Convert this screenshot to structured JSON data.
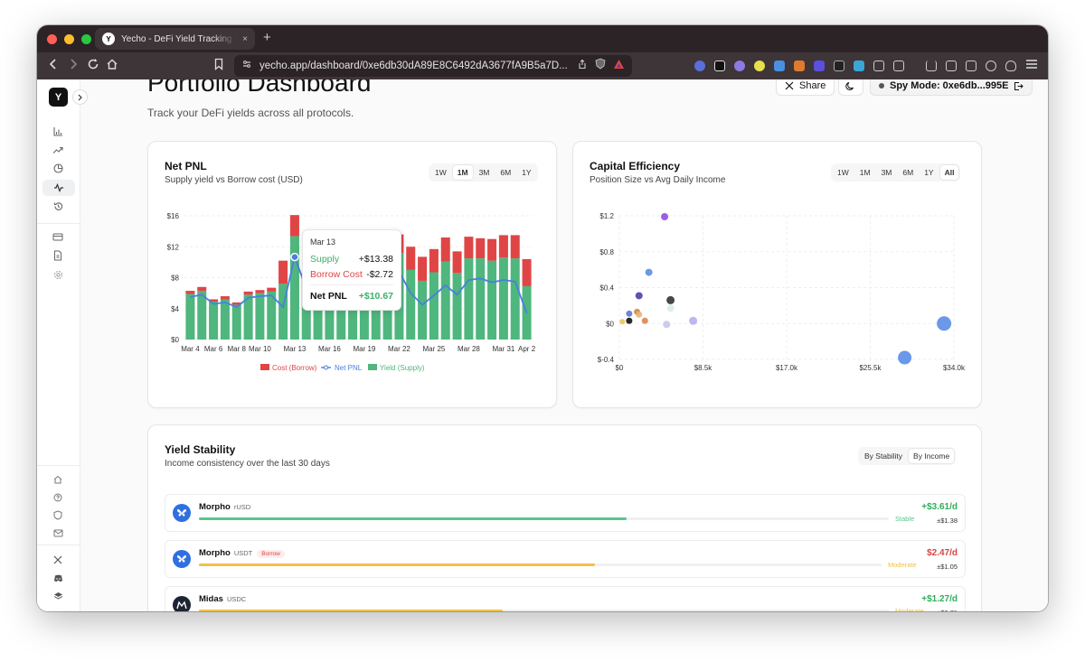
{
  "browser": {
    "tab_title": "Yecho - DeFi Yield Tracking Platform",
    "tab_favicon": "Y",
    "url": "yecho.app/dashboard/0xe6db30dA89E8C6492dA3677fA9B5a7D...",
    "new_tab": "+",
    "close_tab": "×"
  },
  "sidebar": {
    "logo": "Y",
    "collapse_icon": "chevron-right-icon",
    "nav_icons": [
      "bar-chart-icon",
      "trending-up-icon",
      "pie-chart-icon",
      "activity-icon",
      "history-icon",
      "credit-card-icon",
      "document-icon",
      "settings-icon"
    ],
    "footer_icons": [
      "home-icon",
      "help-icon",
      "shield-icon",
      "mail-icon",
      "x-logo-icon",
      "discord-icon",
      "layers-icon"
    ]
  },
  "header": {
    "title": "Portfolio Dashboard",
    "subtitle": "Track your DeFi yields across all protocols.",
    "share_label": "Share",
    "spy_label": "Spy Mode: 0xe6db...995E"
  },
  "net_pnl": {
    "title": "Net PNL",
    "subtitle": "Supply yield vs Borrow cost (USD)",
    "ranges": [
      "1W",
      "1M",
      "3M",
      "6M",
      "1Y"
    ],
    "active_range": "1M",
    "tooltip": {
      "date": "Mar 13",
      "supply_label": "Supply",
      "supply_value": "+$13.38",
      "borrow_label": "Borrow Cost",
      "borrow_value": "-$2.72",
      "net_label": "Net PNL",
      "net_value": "+$10.67"
    }
  },
  "capital_efficiency": {
    "title": "Capital Efficiency",
    "subtitle": "Position Size vs Avg Daily Income",
    "ranges": [
      "1W",
      "1M",
      "3M",
      "6M",
      "1Y",
      "All"
    ],
    "active_range": "All"
  },
  "yield_stability": {
    "title": "Yield Stability",
    "subtitle": "Income consistency over the last 30 days",
    "sort_options": [
      "By Stability",
      "By Income"
    ],
    "active_sort": "By Income",
    "rows": [
      {
        "protocol": "Morpho",
        "asset": "rUSD",
        "badge": "",
        "amount": "+$3.61/d",
        "deviation": "±$1.38",
        "status": "Stable",
        "fill": 0.62,
        "color": "#5bc48c",
        "amount_color": "#2fae5b",
        "logo": "butterfly-icon",
        "logo_bg": "#2f6fe0"
      },
      {
        "protocol": "Morpho",
        "asset": "USDT",
        "badge": "Borrow",
        "amount": "$2.47/d",
        "deviation": "±$1.05",
        "status": "Moderate",
        "fill": 0.58,
        "color": "#f0c24a",
        "amount_color": "#d64545",
        "logo": "butterfly-icon",
        "logo_bg": "#2f6fe0"
      },
      {
        "protocol": "Midas",
        "asset": "USDC",
        "badge": "",
        "amount": "+$1.27/d",
        "deviation": "±$0.71",
        "status": "Moderate",
        "fill": 0.44,
        "color": "#f0c24a",
        "amount_color": "#2fae5b",
        "logo": "midas-icon",
        "logo_bg": "#1d2433"
      }
    ]
  },
  "chart_data": [
    {
      "type": "bar",
      "title": "Net PNL",
      "subtitle": "Supply yield vs Borrow cost (USD)",
      "ylim": [
        0,
        16
      ],
      "yticks": [
        "$0",
        "$4",
        "$8",
        "$12",
        "$16"
      ],
      "ytick_values": [
        0,
        4,
        8,
        12,
        16
      ],
      "categories": [
        "Mar 4",
        "Mar 5",
        "Mar 6",
        "Mar 7",
        "Mar 8",
        "Mar 9",
        "Mar 10",
        "Mar 11",
        "Mar 12",
        "Mar 13",
        "Mar 14",
        "Mar 15",
        "Mar 16",
        "Mar 17",
        "Mar 18",
        "Mar 19",
        "Mar 20",
        "Mar 21",
        "Mar 22",
        "Mar 23",
        "Mar 24",
        "Mar 25",
        "Mar 26",
        "Mar 27",
        "Mar 28",
        "Mar 29",
        "Mar 30",
        "Mar 31",
        "Apr 1",
        "Apr 2"
      ],
      "xtick_labels": [
        "Mar 4",
        "Mar 6",
        "Mar 8",
        "Mar 10",
        "Mar 13",
        "Mar 16",
        "Mar 19",
        "Mar 22",
        "Mar 25",
        "Mar 28",
        "Mar 31",
        "Apr 2"
      ],
      "xtick_index": [
        0,
        2,
        4,
        6,
        9,
        12,
        15,
        18,
        21,
        24,
        27,
        29
      ],
      "series": [
        {
          "name": "Cost (Borrow)",
          "color": "#e04545",
          "values": [
            0.4,
            0.5,
            0.3,
            0.4,
            0.3,
            0.4,
            0.4,
            0.5,
            3.0,
            2.72,
            1.0,
            0.5,
            0.6,
            0.4,
            0.5,
            0.6,
            0.5,
            2.0,
            2.4,
            3.0,
            3.1,
            3.0,
            3.1,
            2.8,
            2.8,
            2.6,
            2.8,
            2.9,
            3.0,
            3.5
          ]
        },
        {
          "name": "Yield (Supply)",
          "color": "#4fb67d",
          "values": [
            5.9,
            6.3,
            4.9,
            5.2,
            4.5,
            5.8,
            6.0,
            6.2,
            7.2,
            13.38,
            7.6,
            8.2,
            7.7,
            8.4,
            8.2,
            9.5,
            8.6,
            8.7,
            11.2,
            9.0,
            7.6,
            8.7,
            10.1,
            8.6,
            10.5,
            10.5,
            10.2,
            10.6,
            10.5,
            6.9
          ]
        },
        {
          "name": "Net PNL",
          "color": "#4a7fe0",
          "values": [
            5.5,
            5.8,
            4.6,
            4.8,
            4.2,
            5.4,
            5.6,
            5.7,
            4.2,
            10.67,
            6.6,
            7.7,
            7.1,
            8.0,
            7.7,
            8.9,
            8.1,
            6.7,
            8.8,
            6.0,
            4.5,
            5.7,
            7.0,
            5.8,
            7.7,
            7.9,
            7.4,
            7.7,
            7.5,
            3.4
          ]
        }
      ],
      "highlight_index": 9,
      "legend": "bottom"
    },
    {
      "type": "scatter",
      "title": "Capital Efficiency",
      "subtitle": "Position Size vs Avg Daily Income",
      "xlim": [
        0,
        34000
      ],
      "ylim": [
        -0.4,
        1.2
      ],
      "xticks": [
        "$0",
        "$8.5k",
        "$17.0k",
        "$25.5k",
        "$34.0k"
      ],
      "xtick_values": [
        0,
        8500,
        17000,
        25500,
        34000
      ],
      "yticks": [
        "$-0.4",
        "$0",
        "$0.4",
        "$0.8",
        "$1.2"
      ],
      "ytick_values": [
        -0.4,
        0,
        0.4,
        0.8,
        1.2
      ],
      "points": [
        {
          "x": 4600,
          "y": 1.19,
          "r": 4,
          "color": "#8f4fe0"
        },
        {
          "x": 3000,
          "y": 0.57,
          "r": 4,
          "color": "#5b8de6"
        },
        {
          "x": 2000,
          "y": 0.31,
          "r": 4,
          "color": "#4b3fa8"
        },
        {
          "x": 5200,
          "y": 0.26,
          "r": 4.5,
          "color": "#333333"
        },
        {
          "x": 5200,
          "y": 0.17,
          "r": 4,
          "color": "#d8ecec"
        },
        {
          "x": 1000,
          "y": 0.11,
          "r": 3.5,
          "color": "#5b78d6"
        },
        {
          "x": 1800,
          "y": 0.13,
          "r": 3.5,
          "color": "#d2883f"
        },
        {
          "x": 2000,
          "y": 0.1,
          "r": 3.5,
          "color": "#e8b27a"
        },
        {
          "x": 2600,
          "y": 0.03,
          "r": 3.5,
          "color": "#e0844f"
        },
        {
          "x": 1000,
          "y": 0.03,
          "r": 3.5,
          "color": "#111111"
        },
        {
          "x": 300,
          "y": 0.02,
          "r": 3,
          "color": "#e8c55a"
        },
        {
          "x": 7500,
          "y": 0.03,
          "r": 4.5,
          "color": "#b7b0ee"
        },
        {
          "x": 4800,
          "y": -0.01,
          "r": 4,
          "color": "#c7c7ee"
        },
        {
          "x": 33000,
          "y": 0,
          "r": 8,
          "color": "#5b8de6"
        },
        {
          "x": 29000,
          "y": -0.38,
          "r": 7.5,
          "color": "#5b8de6"
        }
      ]
    }
  ]
}
